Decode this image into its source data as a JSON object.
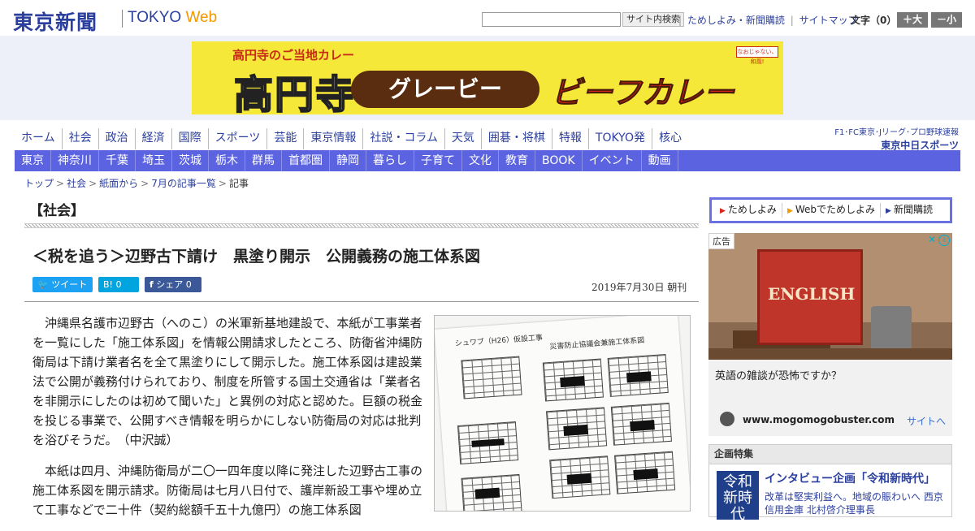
{
  "header": {
    "logo_jp": "東京新聞",
    "logo_en_main": "TOKYO",
    "logo_en_accent": "Web",
    "search_placeholder": "",
    "search_button": "サイト内検索",
    "links": [
      "ためしよみ・新聞購読",
      "サイトマップ"
    ],
    "font_size_label": "文字（0）",
    "font_larger": "＋大",
    "font_smaller": "－小"
  },
  "banner": {
    "sub": "高円寺のご当地カレー",
    "big": "高円寺",
    "pill": "グレービー",
    "curry": "ビーフカレー",
    "tag": "なおじゃない、和風!"
  },
  "nav_primary": [
    "ホーム",
    "社会",
    "政治",
    "経済",
    "国際",
    "スポーツ",
    "芸能",
    "東京情報",
    "社説・コラム",
    "天気",
    "囲碁・将棋",
    "特報",
    "TOKYO発",
    "核心"
  ],
  "chunichi": {
    "line1": "F1･FC東京･Jリーグ･プロ野球速報",
    "line2": "東京中日スポーツ"
  },
  "nav_regional": [
    "東京",
    "神奈川",
    "千葉",
    "埼玉",
    "茨城",
    "栃木",
    "群馬",
    "首都圏",
    "静岡",
    "暮らし",
    "子育て",
    "文化",
    "教育",
    "BOOK",
    "イベント",
    "動画"
  ],
  "breadcrumb": [
    "トップ",
    "社会",
    "紙面から",
    "7月の記事一覧"
  ],
  "breadcrumb_current": "記事",
  "section_title": "【社会】",
  "article": {
    "headline": "＜税を追う＞辺野古下請け　黒塗り開示　公開義務の施工体系図",
    "share_tweet": "ツイート",
    "share_hatena": "B! 0",
    "share_facebook": "シェア 0",
    "dateline": "2019年7月30日 朝刊",
    "paragraphs": [
      "沖縄県名護市辺野古（へのこ）の米軍新基地建設で、本紙が工事業者を一覧にした「施工体系図」を情報公開請求したところ、防衛省沖縄防衛局は下請け業者名を全て黒塗りにして開示した。施工体系図は建設業法で公開が義務付けられており、制度を所管する国土交通省は「業者名を非開示にしたのは初めて聞いた」と異例の対応と認めた。巨額の税金を投じる事業で、公開すべき情報を明らかにしない防衛局の対応は批判を浴びそうだ。　（中沢誠）",
      "本紙は四月、沖縄防衛局が二〇一四年度以降に発注した辺野古工事の施工体系図を開示請求。防衛局は七月八日付で、護岸新設工事や埋め立て工事などで二十件（契約総額千五十九億円）の施工体系図"
    ],
    "photo_caption_1": "シュワブ（H26）仮設工事",
    "photo_caption_2": "災害防止協議会兼施工体系図"
  },
  "sidebar": {
    "tabs": [
      "ためしよみ",
      "Webでためしよみ",
      "新聞購読"
    ],
    "ad": {
      "label": "広告",
      "book_text": "ENGLISH",
      "text": "英語の雑談が恐怖ですか？",
      "url": "www.mogomogobuster.com",
      "cta": "サイトへ"
    },
    "feature": {
      "head": "企画特集",
      "thumb": "令和 新時代",
      "title": "インタビュー企画「令和新時代」",
      "desc": "改革は堅実利益へ。地域の賑わいへ 西京信用金庫 北村啓介理事長"
    }
  },
  "colors": {
    "brand_blue": "#2b3f9e",
    "nav_purple": "#5b63e0",
    "accent_orange": "#f39800"
  }
}
